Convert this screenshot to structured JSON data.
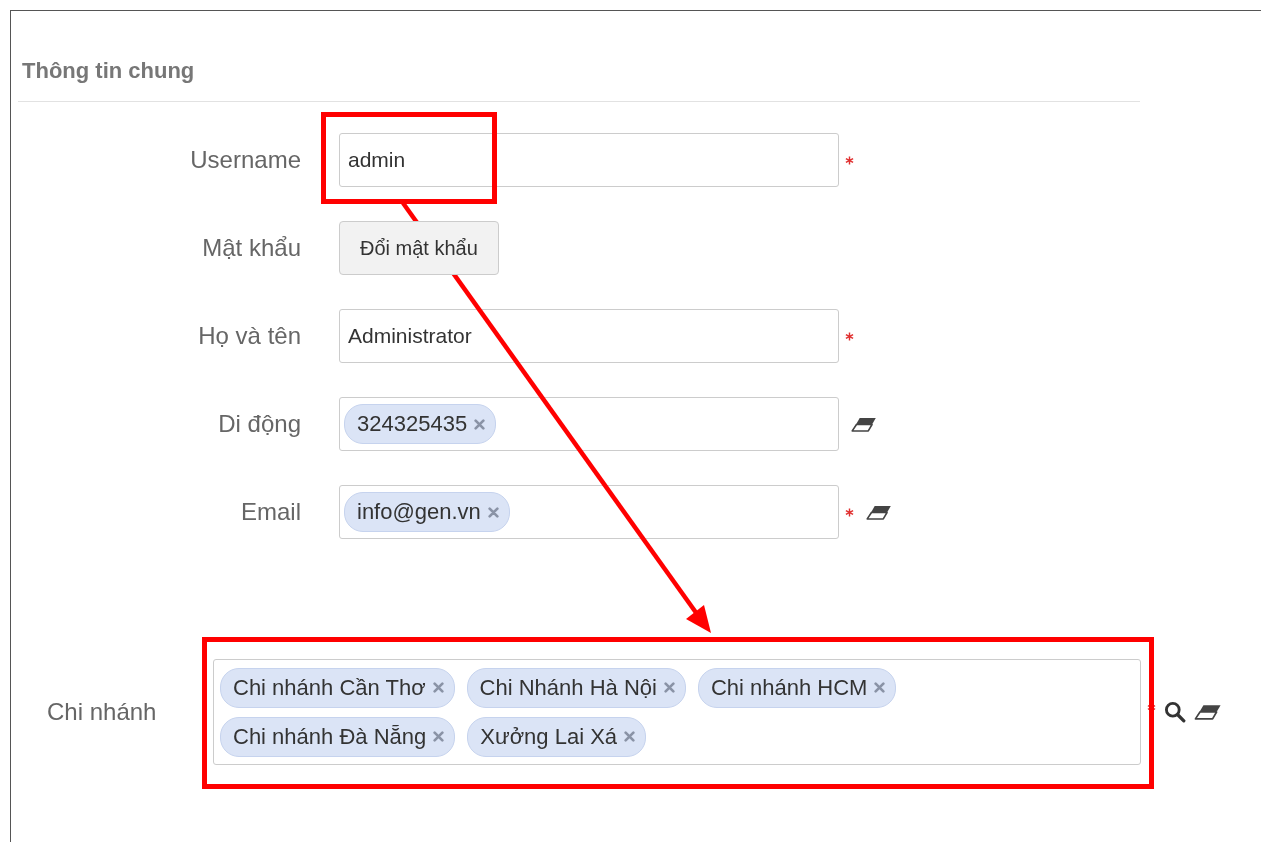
{
  "section": {
    "title": "Thông tin chung"
  },
  "fields": [
    {
      "label": "Username",
      "kind": "text",
      "value": "admin",
      "required": true,
      "clearable": false
    },
    {
      "label": "Mật khẩu",
      "kind": "button",
      "button": "Đổi mật khẩu",
      "required": false,
      "clearable": false
    },
    {
      "label": "Họ và tên",
      "kind": "text",
      "value": "Administrator",
      "required": true,
      "clearable": false
    },
    {
      "label": "Di động",
      "kind": "tags",
      "tags": [
        "324325435"
      ],
      "required": false,
      "clearable": true
    },
    {
      "label": "Email",
      "kind": "tags",
      "tags": [
        "info@gen.vn"
      ],
      "required": true,
      "clearable": true
    }
  ],
  "branch": {
    "label": "Chi nhánh",
    "tags": [
      "Chi nhánh Cần Thơ",
      "Chi Nhánh Hà Nội",
      "Chi nhánh HCM",
      "Chi nhánh Đà Nẵng",
      "Xưởng Lai Xá"
    ],
    "required": true,
    "searchable": true,
    "clearable": true
  }
}
